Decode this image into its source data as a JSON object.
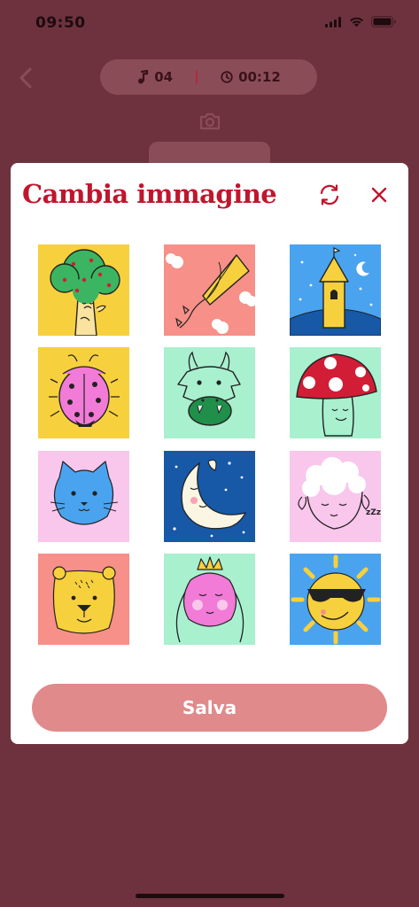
{
  "status_bar": {
    "time": "09:50"
  },
  "header": {
    "tracks_count": "04",
    "duration": "00:12"
  },
  "modal": {
    "title": "Cambia immagine",
    "save_label": "Salva",
    "images": [
      {
        "name": "tree",
        "bg": "#f7d03d"
      },
      {
        "name": "kite",
        "bg": "#f69088"
      },
      {
        "name": "castle",
        "bg": "#4aa3ef"
      },
      {
        "name": "ladybug",
        "bg": "#f7d03d"
      },
      {
        "name": "dragon",
        "bg": "#a9f0cf"
      },
      {
        "name": "mushroom",
        "bg": "#a9f0cf"
      },
      {
        "name": "cat",
        "bg": "#f9c6ec"
      },
      {
        "name": "moon",
        "bg": "#1758a7"
      },
      {
        "name": "sheep",
        "bg": "#f9c6ec"
      },
      {
        "name": "bear",
        "bg": "#f69088"
      },
      {
        "name": "princess",
        "bg": "#a9f0cf"
      },
      {
        "name": "sun",
        "bg": "#4aa3ef"
      }
    ]
  }
}
